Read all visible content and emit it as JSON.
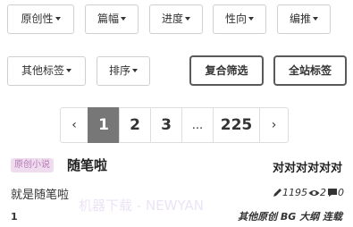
{
  "filters": {
    "row1": [
      {
        "label": "原创性"
      },
      {
        "label": "篇幅"
      },
      {
        "label": "进度"
      },
      {
        "label": "性向"
      },
      {
        "label": "编推"
      }
    ],
    "row2": [
      {
        "label": "其他标签"
      },
      {
        "label": "排序"
      }
    ],
    "composite_filter_label": "复合筛选",
    "site_tags_label": "全站标签"
  },
  "pagination": {
    "prev": "‹",
    "pages": [
      "1",
      "2",
      "3"
    ],
    "ellipsis": "...",
    "last": "225",
    "next": "›",
    "current": "1"
  },
  "story": {
    "badge": "原创小说",
    "title": "随笔啦",
    "author": "对对对对对对",
    "summary": "就是随笔啦",
    "word_count": "1195",
    "views": "2",
    "comments": "0",
    "tags": "其他原创 BG 大纲 连载",
    "chapter": "1"
  },
  "watermark": "机器下载 - NEWYAN"
}
